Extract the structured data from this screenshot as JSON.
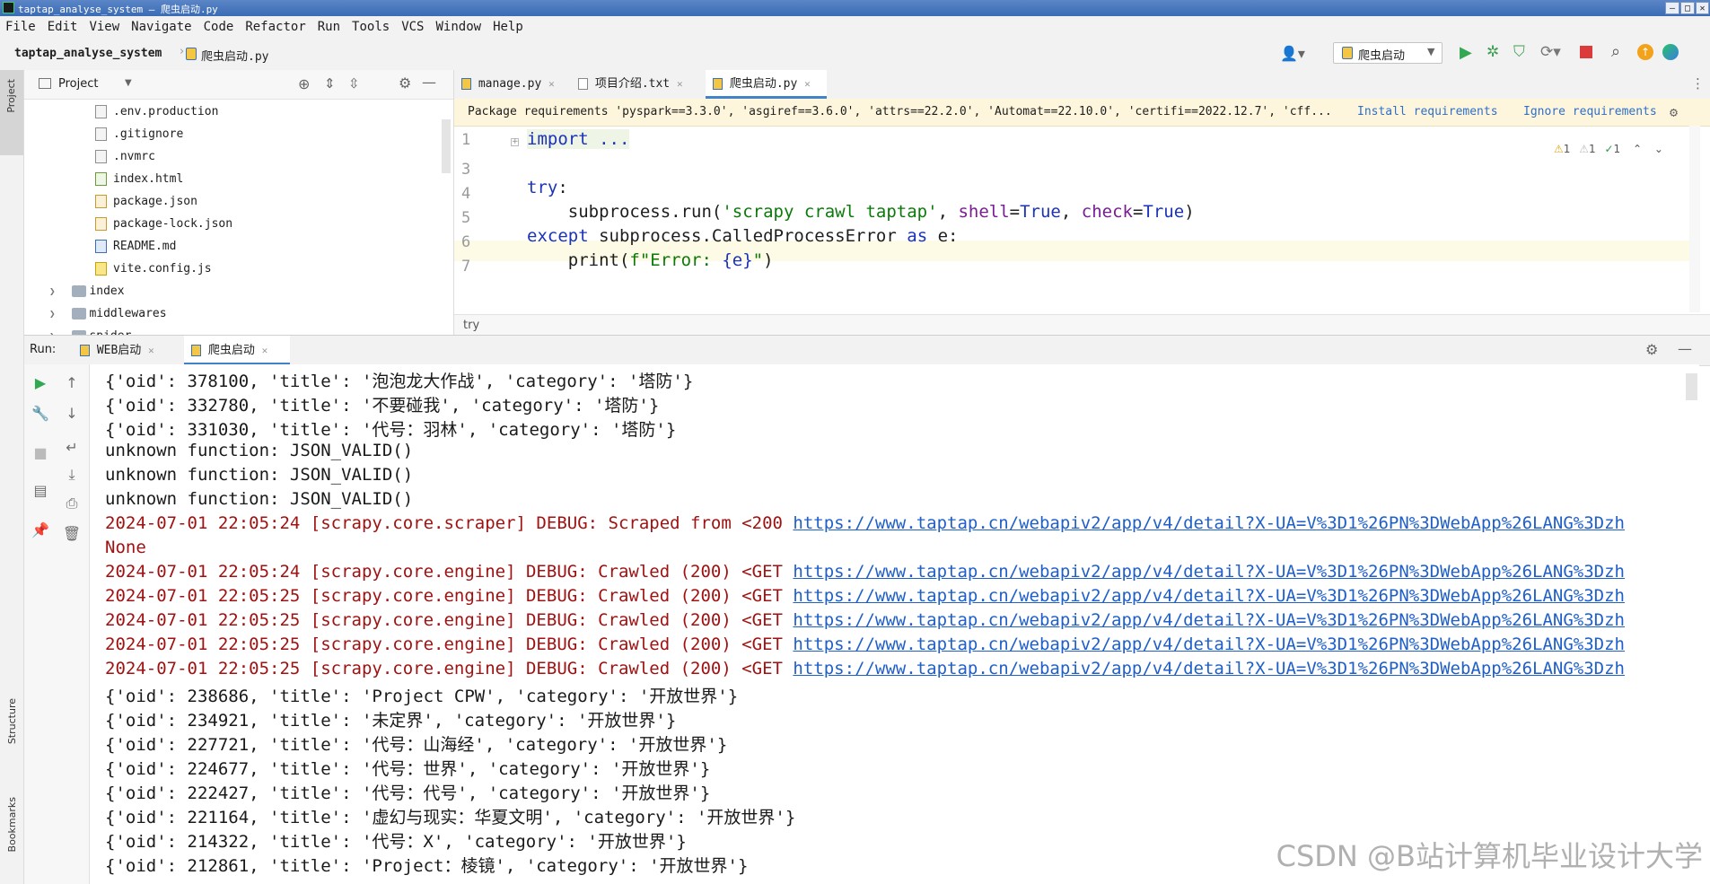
{
  "window": {
    "title": "taptap_analyse_system – 爬虫启动.py",
    "controls": [
      "–",
      "□",
      "✕"
    ]
  },
  "menu": [
    "File",
    "Edit",
    "View",
    "Navigate",
    "Code",
    "Refactor",
    "Run",
    "Tools",
    "VCS",
    "Window",
    "Help"
  ],
  "nav": {
    "project_name": "taptap_analyse_system",
    "current_file": "爬虫启动.py",
    "run_config": "爬虫启动"
  },
  "left_strip": {
    "project": "Project",
    "structure": "Structure",
    "bookmarks": "Bookmarks"
  },
  "project_panel": {
    "title": "Project",
    "tree": [
      {
        "label": ".env.production",
        "kind": "file"
      },
      {
        "label": ".gitignore",
        "kind": "file"
      },
      {
        "label": ".nvmrc",
        "kind": "file"
      },
      {
        "label": "index.html",
        "kind": "html"
      },
      {
        "label": "package.json",
        "kind": "json"
      },
      {
        "label": "package-lock.json",
        "kind": "json"
      },
      {
        "label": "README.md",
        "kind": "md"
      },
      {
        "label": "vite.config.js",
        "kind": "js"
      },
      {
        "label": "index",
        "kind": "folder"
      },
      {
        "label": "middlewares",
        "kind": "folder"
      },
      {
        "label": "spider",
        "kind": "folder"
      }
    ]
  },
  "editor": {
    "tabs": [
      {
        "label": "manage.py",
        "active": false
      },
      {
        "label": "项目介绍.txt",
        "active": false
      },
      {
        "label": "爬虫启动.py",
        "active": true
      }
    ],
    "notice": {
      "text": "Package requirements 'pyspark==3.3.0', 'asgiref==3.6.0', 'attrs==22.2.0', 'Automat==22.10.0', 'certifi==2022.12.7', 'cff...",
      "install": "Install requirements",
      "ignore": "Ignore requirements"
    },
    "inspections": {
      "warn1": "1",
      "warn2": "1",
      "ok": "1"
    },
    "line_numbers": [
      "1",
      "3",
      "4",
      "5",
      "6",
      "7"
    ],
    "code": {
      "l1": "import ...",
      "l4_kw": "try",
      "l4_rest": ":",
      "l5_a": "    subprocess.run(",
      "l5_str": "'scrapy crawl taptap'",
      "l5_b": ", ",
      "l5_p1": "shell",
      "l5_eq1": "=",
      "l5_v1": "True",
      "l5_c": ", ",
      "l5_p2": "check",
      "l5_eq2": "=",
      "l5_v2": "True",
      "l5_d": ")",
      "l6_kw": "except",
      "l6_mid": " subprocess.CalledProcessError ",
      "l6_as": "as",
      "l6_end": " e:",
      "l7_a": "    print(",
      "l7_str": "f\"Error: ",
      "l7_br": "{e}",
      "l7_str2": "\"",
      "l7_b": ")"
    },
    "breadcrumb": "try"
  },
  "run": {
    "label": "Run:",
    "tabs": [
      {
        "label": "WEB启动",
        "active": false
      },
      {
        "label": "爬虫启动",
        "active": true
      }
    ],
    "lines": [
      {
        "text": "{'oid': 378100, 'title': '泡泡龙大作战', 'category': '塔防'}",
        "err": false,
        "link": ""
      },
      {
        "text": "{'oid': 332780, 'title': '不要碰我', 'category': '塔防'}",
        "err": false,
        "link": ""
      },
      {
        "text": "{'oid': 331030, 'title': '代号：羽林', 'category': '塔防'}",
        "err": false,
        "link": ""
      },
      {
        "text": "unknown function: JSON_VALID()",
        "err": false,
        "link": ""
      },
      {
        "text": "unknown function: JSON_VALID()",
        "err": false,
        "link": ""
      },
      {
        "text": "unknown function: JSON_VALID()",
        "err": false,
        "link": ""
      },
      {
        "text": "2024-07-01 22:05:24 [scrapy.core.scraper] DEBUG: Scraped from <200 ",
        "err": true,
        "link": "https://www.taptap.cn/webapiv2/app/v4/detail?X-UA=V%3D1%26PN%3DWebApp%26LANG%3Dzh"
      },
      {
        "text": "None",
        "err": true,
        "link": ""
      },
      {
        "text": "2024-07-01 22:05:24 [scrapy.core.engine] DEBUG: Crawled (200) <GET ",
        "err": true,
        "link": "https://www.taptap.cn/webapiv2/app/v4/detail?X-UA=V%3D1%26PN%3DWebApp%26LANG%3Dzh"
      },
      {
        "text": "2024-07-01 22:05:25 [scrapy.core.engine] DEBUG: Crawled (200) <GET ",
        "err": true,
        "link": "https://www.taptap.cn/webapiv2/app/v4/detail?X-UA=V%3D1%26PN%3DWebApp%26LANG%3Dzh"
      },
      {
        "text": "2024-07-01 22:05:25 [scrapy.core.engine] DEBUG: Crawled (200) <GET ",
        "err": true,
        "link": "https://www.taptap.cn/webapiv2/app/v4/detail?X-UA=V%3D1%26PN%3DWebApp%26LANG%3Dzh"
      },
      {
        "text": "2024-07-01 22:05:25 [scrapy.core.engine] DEBUG: Crawled (200) <GET ",
        "err": true,
        "link": "https://www.taptap.cn/webapiv2/app/v4/detail?X-UA=V%3D1%26PN%3DWebApp%26LANG%3Dzh"
      },
      {
        "text": "2024-07-01 22:05:25 [scrapy.core.engine] DEBUG: Crawled (200) <GET ",
        "err": true,
        "link": "https://www.taptap.cn/webapiv2/app/v4/detail?X-UA=V%3D1%26PN%3DWebApp%26LANG%3Dzh"
      },
      {
        "text": "{'oid': 238686, 'title': 'Project CPW', 'category': '开放世界'}",
        "err": false,
        "link": ""
      },
      {
        "text": "{'oid': 234921, 'title': '未定界', 'category': '开放世界'}",
        "err": false,
        "link": ""
      },
      {
        "text": "{'oid': 227721, 'title': '代号：山海经', 'category': '开放世界'}",
        "err": false,
        "link": ""
      },
      {
        "text": "{'oid': 224677, 'title': '代号：世界', 'category': '开放世界'}",
        "err": false,
        "link": ""
      },
      {
        "text": "{'oid': 222427, 'title': '代号：代号', 'category': '开放世界'}",
        "err": false,
        "link": ""
      },
      {
        "text": "{'oid': 221164, 'title': '虚幻与现实：华夏文明', 'category': '开放世界'}",
        "err": false,
        "link": ""
      },
      {
        "text": "{'oid': 214322, 'title': '代号：X', 'category': '开放世界'}",
        "err": false,
        "link": ""
      },
      {
        "text": "{'oid': 212861, 'title': 'Project：棱镜', 'category': '开放世界'}",
        "err": false,
        "link": ""
      }
    ]
  },
  "watermark": "CSDN @B站计算机毕业设计大学",
  "colors": {
    "error_text": "#a01212",
    "link": "#1f5fc9",
    "keyword": "#1a33b8",
    "string": "#0b7a0b",
    "accent": "#4083c9"
  }
}
